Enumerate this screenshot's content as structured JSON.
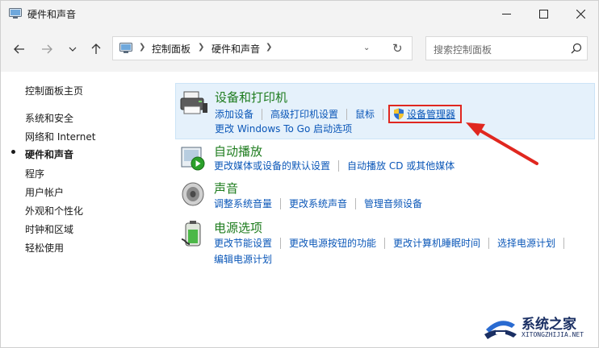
{
  "window": {
    "title": "硬件和声音"
  },
  "address": {
    "crumbs": [
      "控制面板",
      "硬件和声音"
    ],
    "search_placeholder": "搜索控制面板"
  },
  "leftnav": {
    "items": [
      "控制面板主页",
      "系统和安全",
      "网络和 Internet",
      "硬件和声音",
      "程序",
      "用户帐户",
      "外观和个性化",
      "时钟和区域",
      "轻松使用"
    ],
    "active_index": 3
  },
  "categories": [
    {
      "title": "设备和打印机",
      "icon": "printer-icon",
      "row1": [
        "添加设备",
        "高级打印机设置",
        "鼠标",
        "设备管理器"
      ],
      "row2": [
        "更改 Windows To Go 启动选项"
      ]
    },
    {
      "title": "自动播放",
      "icon": "autoplay-icon",
      "row1": [
        "更改媒体或设备的默认设置",
        "自动播放 CD 或其他媒体"
      ]
    },
    {
      "title": "声音",
      "icon": "speaker-icon",
      "row1": [
        "调整系统音量",
        "更改系统声音",
        "管理音频设备"
      ]
    },
    {
      "title": "电源选项",
      "icon": "battery-icon",
      "row1": [
        "更改节能设置",
        "更改电源按钮的功能",
        "更改计算机睡眠时间",
        "选择电源计划"
      ],
      "row2": [
        "编辑电源计划"
      ]
    }
  ],
  "watermark": {
    "name": "系统之家",
    "url": "XITONGZHIJIA.NET"
  },
  "colors": {
    "link": "#0b57b8",
    "category_title": "#1e7c1e",
    "highlight_box": "#e0271f",
    "hover_bg": "#e5f1fb"
  }
}
